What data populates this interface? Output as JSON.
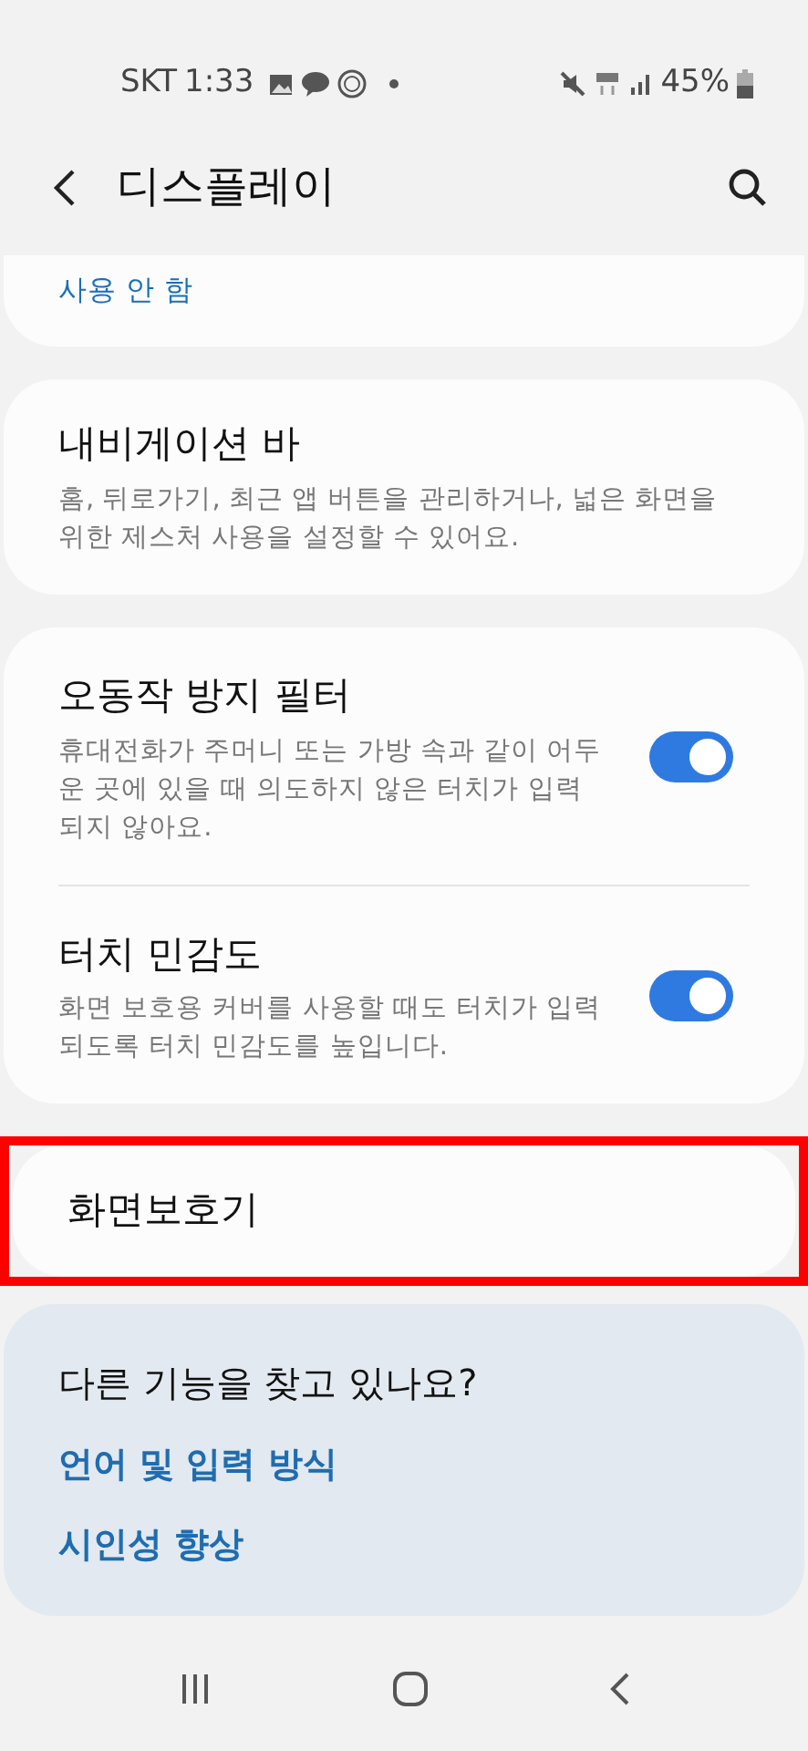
{
  "status_bar": {
    "carrier": "SKT",
    "time": "1:33",
    "battery": "45%"
  },
  "header": {
    "title": "디스플레이"
  },
  "groups": [
    {
      "items": [
        {
          "kind": "text",
          "title_cut": true,
          "subtitle": "사용 안 함",
          "subtitle_accent": true
        }
      ]
    },
    {
      "items": [
        {
          "kind": "text",
          "title": "내비게이션 바",
          "subtitle": "홈, 뒤로가기, 최근 앱 버튼을 관리하거나, 넓은 화면을 위한 제스처 사용을 설정할 수 있어요."
        }
      ]
    },
    {
      "items": [
        {
          "kind": "switch",
          "title": "오동작 방지 필터",
          "subtitle": "휴대전화가 주머니 또는 가방 속과 같이 어두운 곳에 있을 때 의도하지 않은 터치가 입력되지 않아요.",
          "on": true
        },
        {
          "kind": "switch",
          "title": "터치 민감도",
          "subtitle": "화면 보호용 커버를 사용할 때도 터치가 입력되도록 터치 민감도를 높입니다.",
          "on": true
        }
      ]
    },
    {
      "highlighted": true,
      "items": [
        {
          "kind": "text",
          "title": "화면보호기"
        }
      ]
    }
  ],
  "suggestions": {
    "title": "다른 기능을 찾고 있나요?",
    "links": [
      "언어 및 입력 방식",
      "시인성 향상"
    ]
  }
}
